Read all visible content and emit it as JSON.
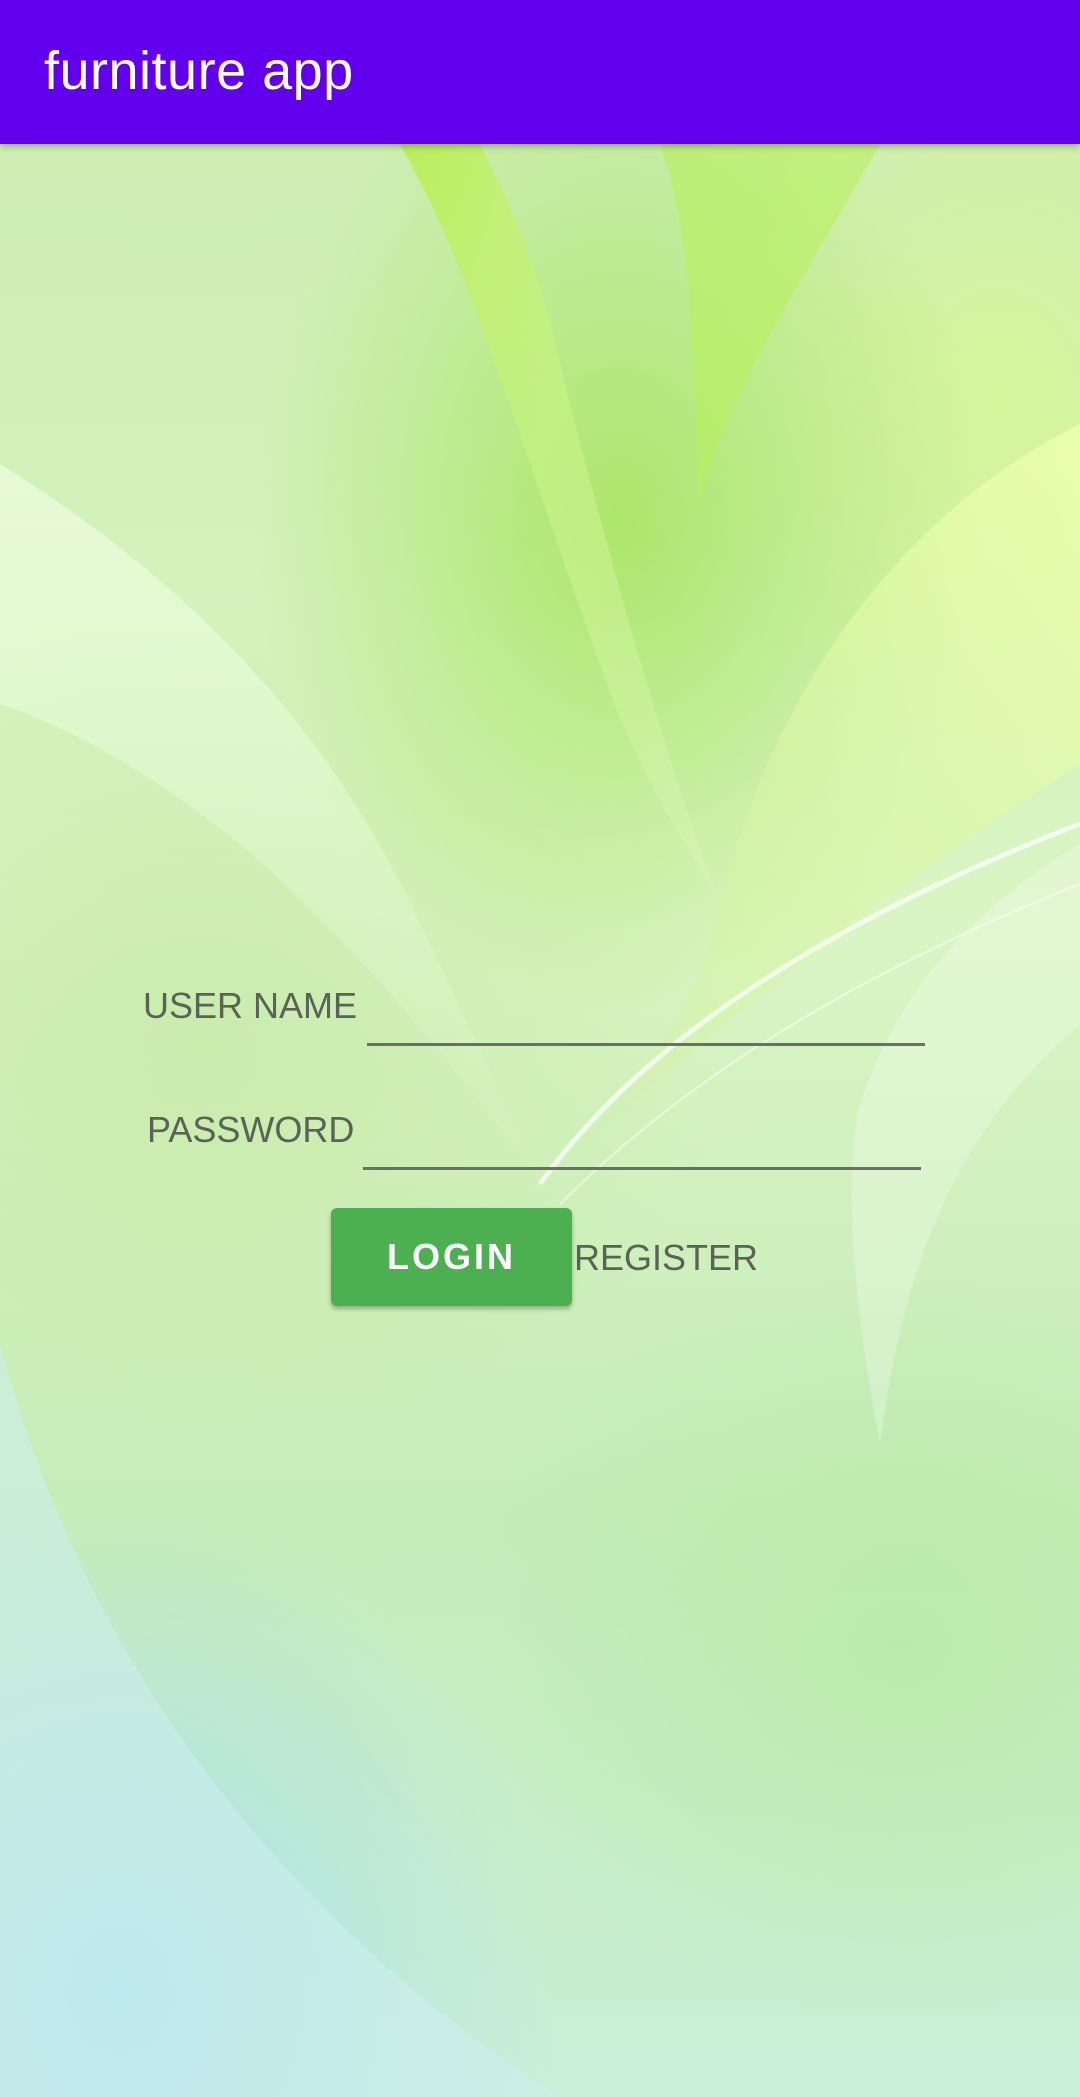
{
  "app_bar": {
    "title": "furniture app",
    "color": "#6200ee"
  },
  "login_form": {
    "username_label": "USER NAME",
    "username_value": "",
    "password_label": "PASSWORD",
    "password_value": "",
    "login_button_label": "LOGIN",
    "login_button_color": "#4caf50",
    "register_label": "REGISTER"
  },
  "background": {
    "icon": "green-leaf-wallpaper"
  }
}
